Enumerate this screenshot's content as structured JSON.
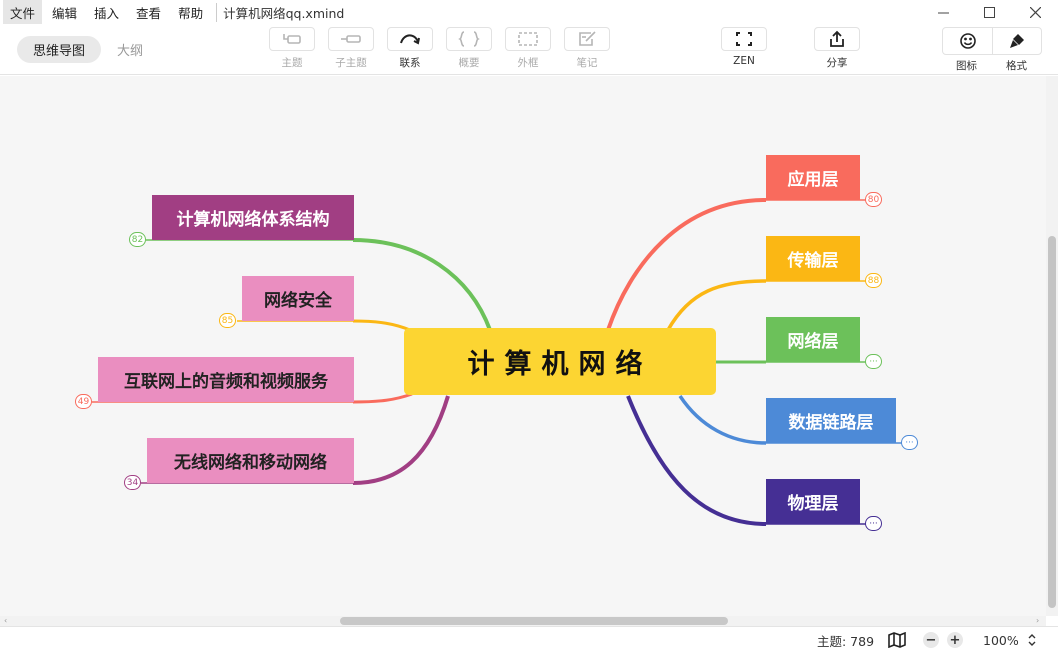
{
  "menu": [
    "文件",
    "编辑",
    "插入",
    "查看",
    "帮助"
  ],
  "document_title": "计算机网络qq.xmind",
  "window_controls": {
    "minimize": "—",
    "maximize": "☐",
    "close": "✕"
  },
  "view_tabs": [
    {
      "label": "思维导图",
      "active": true
    },
    {
      "label": "大纲",
      "active": false
    }
  ],
  "toolbar": {
    "topic": {
      "label": "主题",
      "icon": "topic-icon",
      "enabled": false
    },
    "subtopic": {
      "label": "子主题",
      "icon": "subtopic-icon",
      "enabled": false
    },
    "relationship": {
      "label": "联系",
      "icon": "relationship-icon",
      "enabled": true
    },
    "summary": {
      "label": "概要",
      "icon": "summary-icon",
      "enabled": false
    },
    "boundary": {
      "label": "外框",
      "icon": "boundary-icon",
      "enabled": false
    },
    "note": {
      "label": "笔记",
      "icon": "note-icon",
      "enabled": false
    },
    "zen": {
      "label": "ZEN",
      "icon": "fullscreen-icon",
      "enabled": true
    },
    "share": {
      "label": "分享",
      "icon": "share-icon",
      "enabled": true
    },
    "icons": {
      "label": "图标",
      "icon": "smiley-icon"
    },
    "format": {
      "label": "格式",
      "icon": "brush-icon"
    }
  },
  "mindmap": {
    "central": {
      "label": "计算机网络",
      "color": "#fcd532"
    },
    "right_topics": [
      {
        "label": "应用层",
        "color": "#f96b5d",
        "badge": "80"
      },
      {
        "label": "传输层",
        "color": "#fbb714",
        "badge": "88"
      },
      {
        "label": "网络层",
        "color": "#6cc15a",
        "badge": "···"
      },
      {
        "label": "数据链路层",
        "color": "#4d8ad7",
        "badge": "···"
      },
      {
        "label": "物理层",
        "color": "#452f94",
        "badge": "···"
      }
    ],
    "left_topics": [
      {
        "label": "计算机网络体系结构",
        "box_color": "#a13e83",
        "text_color": "#ffffff",
        "line_color": "#6cc15a",
        "badge": "82"
      },
      {
        "label": "网络安全",
        "box_color": "#ea8ec0",
        "text_color": "#222222",
        "line_color": "#fbb714",
        "badge": "85"
      },
      {
        "label": "互联网上的音频和视频服务",
        "box_color": "#ea8ec0",
        "text_color": "#222222",
        "line_color": "#f96b5d",
        "badge": "49"
      },
      {
        "label": "无线网络和移动网络",
        "box_color": "#ea8ec0",
        "text_color": "#222222",
        "line_color": "#a13e83",
        "badge": "34"
      }
    ]
  },
  "status": {
    "topic_count": "主题: 789",
    "zoom": "100%",
    "zoom_out": "−",
    "zoom_in": "+"
  }
}
